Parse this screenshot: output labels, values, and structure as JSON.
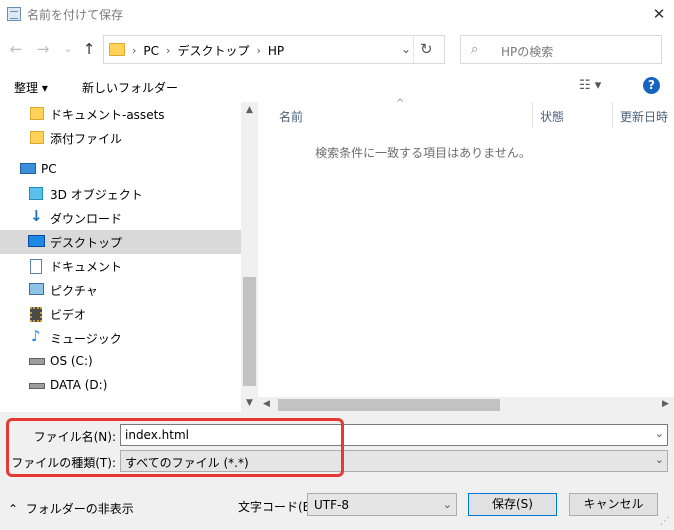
{
  "window": {
    "title": "名前を付けて保存",
    "close_glyph": "✕"
  },
  "nav_buttons": {
    "back": "←",
    "forward": "→",
    "recent": "⌄",
    "up": "↑"
  },
  "address": {
    "crumbs": [
      "PC",
      "デスクトップ",
      "HP"
    ],
    "sep": "›",
    "drop": "⌄",
    "refresh": "↻"
  },
  "search": {
    "icon": "⌕",
    "placeholder": "HPの検索"
  },
  "toolbar": {
    "organize_label": "整理 ▾",
    "new_folder_label": "新しいフォルダー",
    "view_label": "☷ ▾",
    "help_label": "?"
  },
  "sidebar": {
    "items": [
      {
        "label": "ドキュメント-assets",
        "icon": "folder-icon"
      },
      {
        "label": "添付ファイル",
        "icon": "folder-icon"
      },
      {
        "label": "PC",
        "icon": "pc-icon"
      },
      {
        "label": "3D オブジェクト",
        "icon": "3d-objects-icon"
      },
      {
        "label": "ダウンロード",
        "icon": "download-icon"
      },
      {
        "label": "デスクトップ",
        "icon": "desktop-icon",
        "selected": true
      },
      {
        "label": "ドキュメント",
        "icon": "document-icon"
      },
      {
        "label": "ピクチャ",
        "icon": "pictures-icon"
      },
      {
        "label": "ビデオ",
        "icon": "video-icon"
      },
      {
        "label": "ミュージック",
        "icon": "music-icon"
      },
      {
        "label": "OS (C:)",
        "icon": "drive-icon"
      },
      {
        "label": "DATA (D:)",
        "icon": "drive-icon"
      }
    ]
  },
  "file_list": {
    "columns": [
      "名前",
      "状態",
      "更新日時"
    ],
    "empty_message": "検索条件に一致する項目はありません。"
  },
  "form": {
    "filename_label": "ファイル名(N):",
    "filename_value": "index.html",
    "filetype_label": "ファイルの種類(T):",
    "filetype_value": "すべてのファイル  (*.*)",
    "dropdown_glyph": "⌄"
  },
  "footer": {
    "hide_folders_label": "フォルダーの非表示",
    "hide_folders_glyph": "⌃",
    "encoding_label": "文字コード(E):",
    "encoding_value": "UTF-8",
    "save_label": "保存(S)",
    "cancel_label": "キャンセル"
  },
  "colors": {
    "accent": "#0078d7",
    "highlight": "#e53935",
    "selected_row": "#d9d9d9"
  }
}
